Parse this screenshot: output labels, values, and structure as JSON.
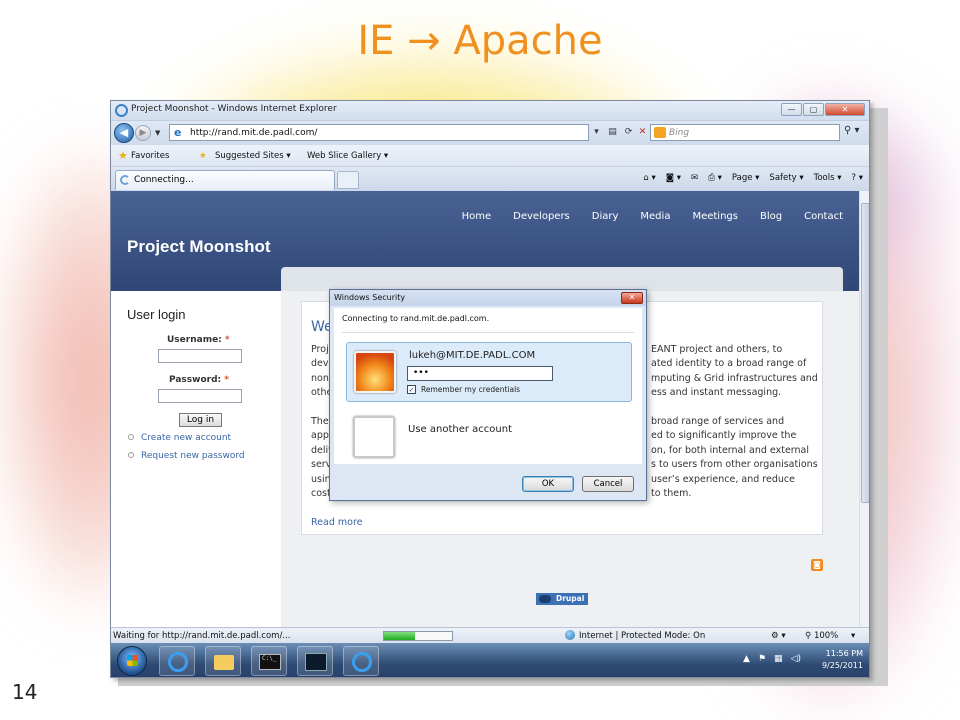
{
  "slide": {
    "title": "IE  Apache",
    "arrow": "→",
    "number": "14"
  },
  "window": {
    "title": "Project Moonshot - Windows Internet Explorer",
    "minimize": "—",
    "maximize": "▢",
    "close": "✕"
  },
  "address": {
    "url": "http://rand.mit.de.padl.com/",
    "search_placeholder": "Bing"
  },
  "favorites_bar": {
    "favorites": "Favorites",
    "suggested_sites": "Suggested Sites ▾",
    "web_slice_gallery": "Web Slice Gallery ▾"
  },
  "tab": {
    "label": "Connecting..."
  },
  "command_bar": {
    "page": "Page ▾",
    "safety": "Safety ▾",
    "tools": "Tools ▾"
  },
  "site": {
    "nav": [
      "Home",
      "Developers",
      "Diary",
      "Media",
      "Meetings",
      "Blog",
      "Contact"
    ],
    "title": "Project Moonshot",
    "login": {
      "title": "User login",
      "username_label": "Username:",
      "password_label": "Password:",
      "required": "*",
      "login_button": "Log in",
      "create_account": "Create new account",
      "request_password": "Request new password"
    },
    "article": {
      "title_fragment": "We",
      "left_fragments": [
        "Proj",
        "devi",
        "non",
        "othe",
        "",
        "The",
        "appr",
        "deliv",
        "serv",
        "usin",
        "cost"
      ],
      "right_fragments": [
        "EANT project and others, to",
        "ated identity to a broad range of",
        "mputing & Grid infrastructures and",
        "ess and instant messaging.",
        "",
        "broad range of services and",
        "ed to significantly improve the",
        "on, for both internal and external",
        "s to users from other organisations",
        "user’s experience, and reduce",
        "to them."
      ],
      "read_more": "Read more"
    },
    "drupal_badge": "Drupal"
  },
  "dialog": {
    "title": "Windows Security",
    "close": "✕",
    "connecting": "Connecting to rand.mit.de.padl.com.",
    "user": "lukeh@MIT.DE.PADL.COM",
    "password_mask": "•••",
    "remember_label": "Remember my credentials",
    "remember_checked": "✓",
    "other_account": "Use another account",
    "ok": "OK",
    "cancel": "Cancel"
  },
  "status": {
    "text": "Waiting for http://rand.mit.de.padl.com/...",
    "progress": 0.45,
    "zone": "Internet | Protected Mode: On",
    "zoom": "100%"
  },
  "taskbar": {
    "cmd_text": "C:\\_",
    "time": "11:56 PM",
    "date": "9/25/2011"
  },
  "colors": {
    "slide_title": "#f0901e",
    "site_header": "#3b5283",
    "link": "#3a66a6"
  }
}
